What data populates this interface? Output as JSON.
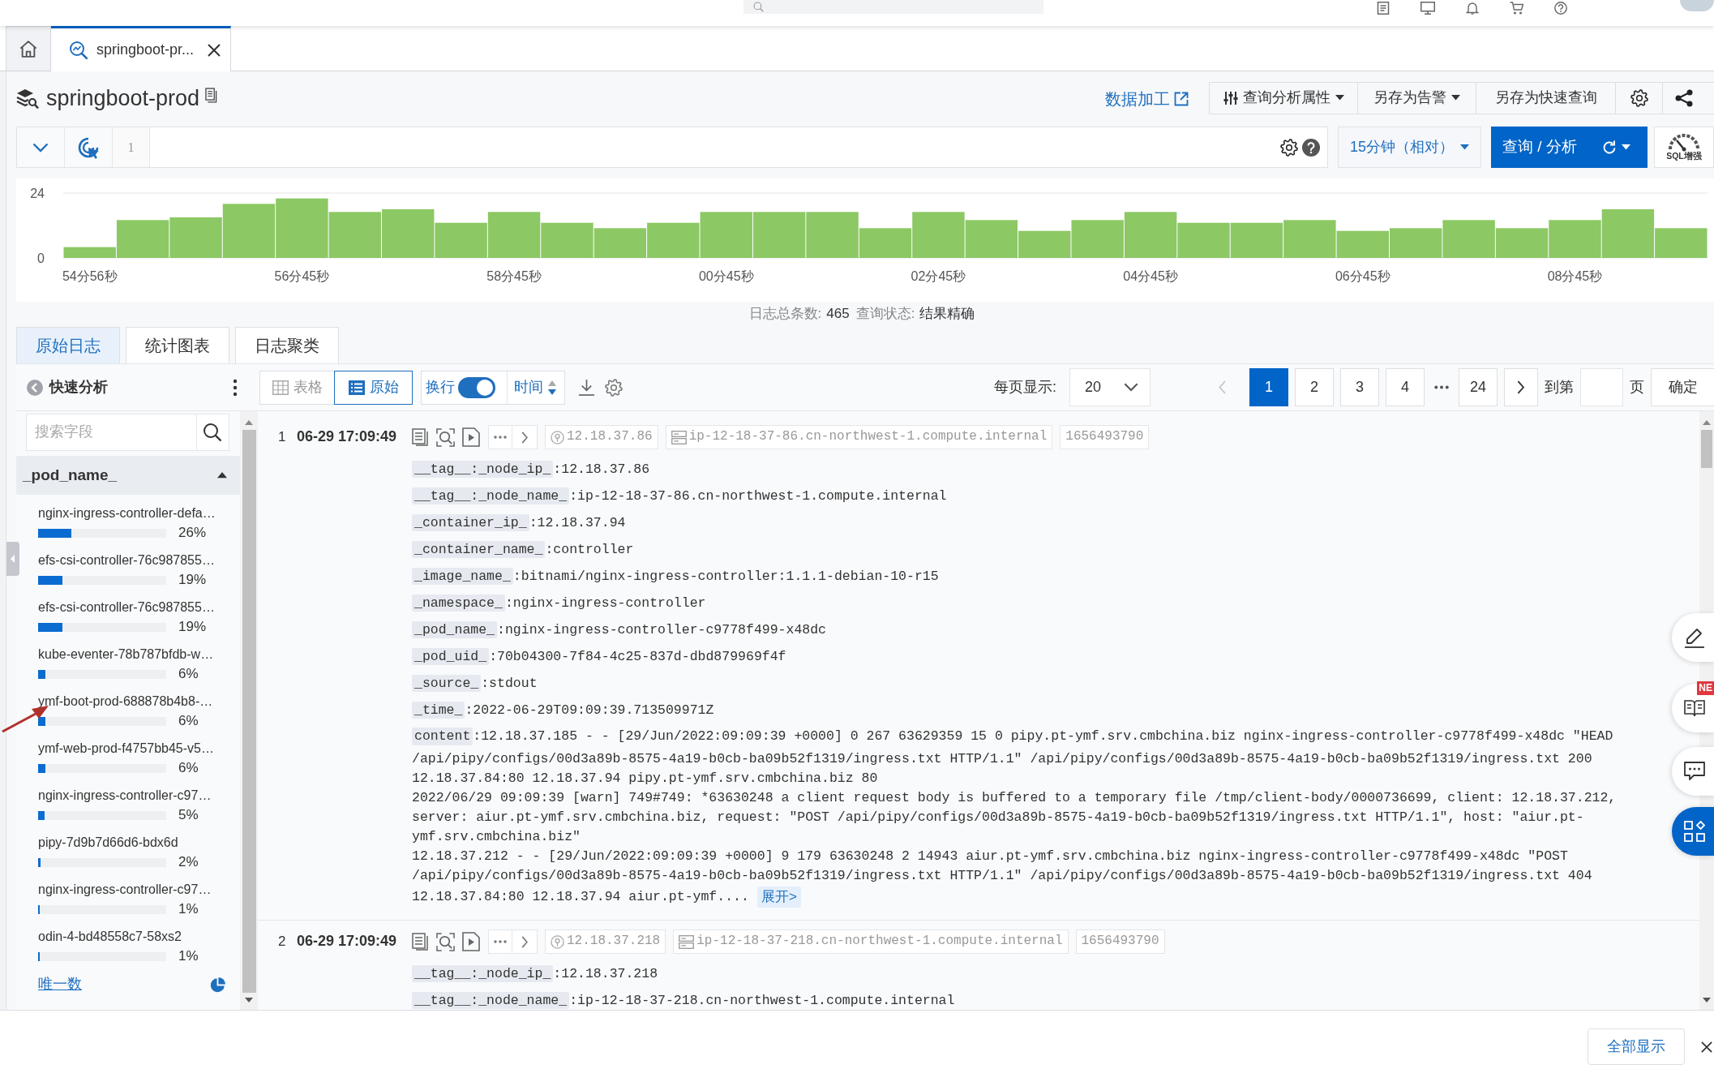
{
  "tabs": [
    {
      "kind": "home",
      "selected": false
    },
    {
      "kind": "query",
      "label": "springboot-pr...",
      "selected": true
    }
  ],
  "logstore": {
    "title": "springboot-prod"
  },
  "actions": {
    "link": "数据加工",
    "buttons": [
      {
        "kind": "icon-menu",
        "label": "查询分析属性"
      },
      {
        "kind": "menu",
        "label": "另存为告警"
      },
      {
        "kind": "plain",
        "label": "另存为快速查询"
      }
    ]
  },
  "query": {
    "line_number": "1",
    "time_range": "15分钟（相对）",
    "submit": "查询 / 分析",
    "sql_badge": "SQL增强"
  },
  "histogram": {
    "chart_data": {
      "type": "bar",
      "categories": [
        "54分56秒",
        null,
        null,
        null,
        "56分45秒",
        null,
        null,
        null,
        "58分45秒",
        null,
        null,
        null,
        "00分45秒",
        null,
        null,
        null,
        "02分45秒",
        null,
        null,
        null,
        "04分45秒",
        null,
        null,
        null,
        "06分45秒",
        null,
        null,
        null,
        "08分45秒",
        null,
        null
      ],
      "values": [
        4,
        14,
        15,
        20,
        22,
        17,
        18,
        13,
        17,
        13,
        11,
        13,
        17,
        17,
        17,
        11,
        17,
        14,
        10,
        14,
        17,
        13,
        13,
        14,
        10,
        11,
        14,
        11,
        14,
        18,
        11
      ],
      "ylim": [
        0,
        24
      ],
      "yticks": [
        0,
        24
      ]
    }
  },
  "summary": [
    {
      "label": "日志总条数:",
      "value": "465"
    },
    {
      "label": "查询状态:",
      "value": "结果精确"
    }
  ],
  "view_tabs": [
    {
      "label": "原始日志",
      "selected": true
    },
    {
      "label": "统计图表",
      "selected": false
    },
    {
      "label": "日志聚类",
      "selected": false
    }
  ],
  "quick_analysis": {
    "title": "快速分析",
    "search": {
      "placeholder": "搜索字段"
    },
    "field": {
      "name": "_pod_name_",
      "expanded": true
    },
    "items": [
      {
        "name": "nginx-ingress-controller-defa…",
        "percent": "26%",
        "level": 0.26
      },
      {
        "name": "efs-csi-controller-76c987855…",
        "percent": "19%",
        "level": 0.19
      },
      {
        "name": "efs-csi-controller-76c987855…",
        "percent": "19%",
        "level": 0.19
      },
      {
        "name": "kube-eventer-78b787bfdb-w…",
        "percent": "6%",
        "level": 0.06
      },
      {
        "name": "ymf-boot-prod-688878b4b8-…",
        "percent": "6%",
        "level": 0.06
      },
      {
        "name": "ymf-web-prod-f4757bb45-v5…",
        "percent": "6%",
        "level": 0.06
      },
      {
        "name": "nginx-ingress-controller-c97…",
        "percent": "5%",
        "level": 0.05
      },
      {
        "name": "pipy-7d9b7d66d6-bdx6d",
        "percent": "2%",
        "level": 0.02
      },
      {
        "name": "nginx-ingress-controller-c97…",
        "percent": "1%",
        "level": 0.01
      },
      {
        "name": "odin-4-bd48558c7-58xs2",
        "percent": "1%",
        "level": 0.01
      }
    ],
    "footer": "唯一数"
  },
  "toolbar": {
    "modes": [
      {
        "kind": "table",
        "label": "表格",
        "selected": false
      },
      {
        "kind": "raw",
        "label": "原始",
        "selected": true
      }
    ],
    "wrap": {
      "label": "换行",
      "on": true
    },
    "sort": {
      "label": "时间"
    },
    "page_size": {
      "label": "每页显示:",
      "value": "20"
    },
    "pagination": {
      "prev": {
        "disabled": true
      },
      "pages": [
        {
          "kind": "page",
          "label": "1",
          "selected": true
        },
        {
          "kind": "page",
          "label": "2",
          "selected": false
        },
        {
          "kind": "page",
          "label": "3",
          "selected": false
        },
        {
          "kind": "page",
          "label": "4",
          "selected": false
        },
        {
          "kind": "gap"
        },
        {
          "kind": "page",
          "label": "24",
          "selected": false
        }
      ],
      "next": {
        "disabled": false
      },
      "goto_label": "到第",
      "goto_unit": "页",
      "confirm": "确定"
    }
  },
  "logs": [
    {
      "index": "1",
      "time": "06-29 17:09:49",
      "tags": [
        {
          "kind": "ip",
          "text": "12.18.37.86"
        },
        {
          "kind": "host",
          "text": "ip-12-18-37-86.cn-northwest-1.compute.internal"
        },
        {
          "kind": "plain",
          "text": "1656493790"
        }
      ],
      "fields": [
        {
          "key": "__tag__:_node_ip_",
          "value": ":12.18.37.86"
        },
        {
          "key": "__tag__:_node_name_",
          "value": ":ip-12-18-37-86.cn-northwest-1.compute.internal"
        },
        {
          "key": "_container_ip_",
          "value": ":12.18.37.94"
        },
        {
          "key": "_container_name_",
          "value": ":controller"
        },
        {
          "key": "_image_name_",
          "value": ":bitnami/nginx-ingress-controller:1.1.1-debian-10-r15"
        },
        {
          "key": "_namespace_",
          "value": ":nginx-ingress-controller"
        },
        {
          "key": "_pod_name_",
          "value": ":nginx-ingress-controller-c9778f499-x48dc"
        },
        {
          "key": "_pod_uid_",
          "value": ":70b04300-7f84-4c25-837d-dbd879969f4f"
        },
        {
          "key": "_source_",
          "value": ":stdout"
        },
        {
          "key": "_time_",
          "value": ":2022-06-29T09:09:39.713509971Z"
        }
      ],
      "content": {
        "key": "content",
        "lines": [
          ":12.18.37.185 - - [29/Jun/2022:09:09:39 +0000] 0 267 63629359 15 0 pipy.pt-ymf.srv.cmbchina.biz nginx-ingress-controller-c9778f499-x48dc \"HEAD",
          "/api/pipy/configs/00d3a89b-8575-4a19-b0cb-ba09b52f1319/ingress.txt HTTP/1.1\" /api/pipy/configs/00d3a89b-8575-4a19-b0cb-ba09b52f1319/ingress.txt 200",
          "12.18.37.84:80 12.18.37.94 pipy.pt-ymf.srv.cmbchina.biz 80",
          "2022/06/29 09:09:39 [warn] 749#749: *63630248 a client request body is buffered to a temporary file /tmp/client-body/0000736699, client: 12.18.37.212,",
          "server: aiur.pt-ymf.srv.cmbchina.biz, request: \"POST /api/pipy/configs/00d3a89b-8575-4a19-b0cb-ba09b52f1319/ingress.txt HTTP/1.1\", host: \"aiur.pt-",
          "ymf.srv.cmbchina.biz\"",
          "12.18.37.212 - - [29/Jun/2022:09:09:39 +0000] 9 179 63630248 2 14943 aiur.pt-ymf.srv.cmbchina.biz nginx-ingress-controller-c9778f499-x48dc \"POST",
          "/api/pipy/configs/00d3a89b-8575-4a19-b0cb-ba09b52f1319/ingress.txt HTTP/1.1\" /api/pipy/configs/00d3a89b-8575-4a19-b0cb-ba09b52f1319/ingress.txt 404",
          "12.18.37.84:80 12.18.37.94 aiur.pt-ymf...."
        ],
        "more": "展开>"
      }
    },
    {
      "index": "2",
      "time": "06-29 17:09:49",
      "tags": [
        {
          "kind": "ip",
          "text": "12.18.37.218"
        },
        {
          "kind": "host",
          "text": "ip-12-18-37-218.cn-northwest-1.compute.internal"
        },
        {
          "kind": "plain",
          "text": "1656493790"
        }
      ],
      "fields": [
        {
          "key": "__tag__:_node_ip_",
          "value": ":12.18.37.218"
        },
        {
          "key": "__tag__:_node_name_",
          "value": ":ip-12-18-37-218.cn-northwest-1.compute.internal"
        }
      ]
    }
  ],
  "side_tools": {
    "badge": "NE"
  },
  "footer": {
    "show_all": "全部显示"
  }
}
